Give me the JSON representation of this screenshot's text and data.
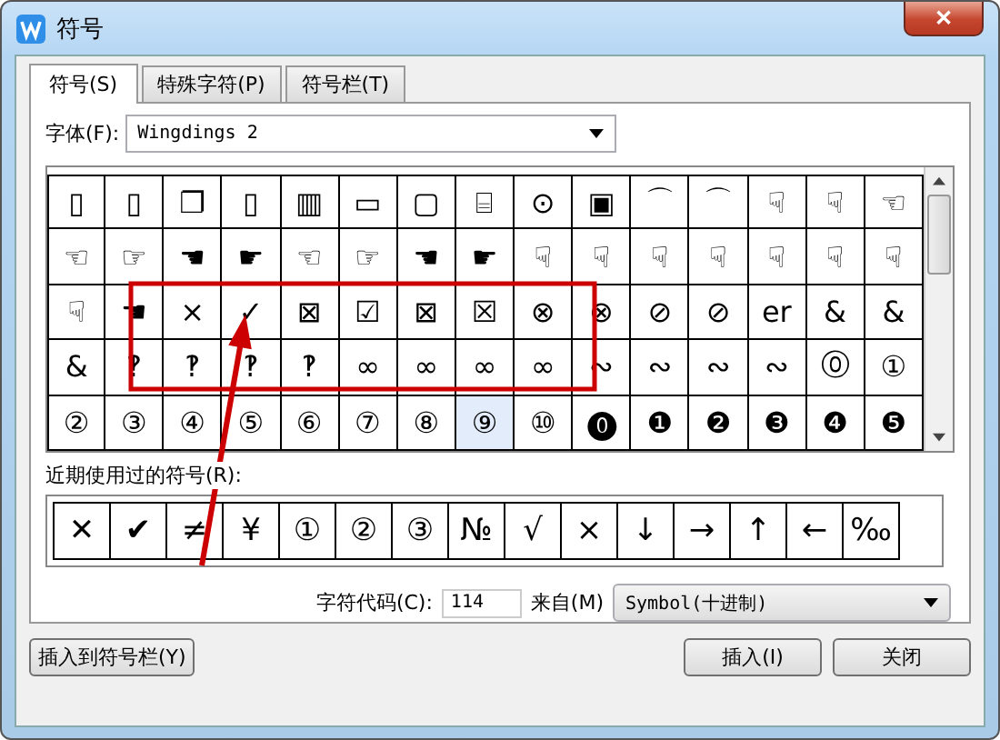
{
  "window": {
    "title": "符号",
    "close": "✕"
  },
  "tabs": [
    {
      "label": "符号(S)",
      "selected": true
    },
    {
      "label": "特殊字符(P)",
      "selected": false
    },
    {
      "label": "符号栏(T)",
      "selected": false
    }
  ],
  "font": {
    "label": "字体(F):",
    "value": "Wingdings 2"
  },
  "symbols": [
    {
      "cells": [
        "▯",
        "▯",
        "❐",
        "▯",
        "▥",
        "▭",
        "▢",
        "⌸",
        "⊙",
        "▣",
        "⌒",
        "⌒",
        "☟",
        "☟",
        "☜"
      ],
      "selected": [
        false,
        false,
        false,
        false,
        false,
        false,
        false,
        false,
        false,
        false,
        false,
        false,
        false,
        false,
        false
      ]
    },
    {
      "cells": [
        "☜",
        "☞",
        "☚",
        "☛",
        "☜",
        "☞",
        "☚",
        "☛",
        "☟",
        "☟",
        "☟",
        "☟",
        "☟",
        "☟",
        "☟"
      ],
      "selected": [
        false,
        false,
        false,
        false,
        false,
        false,
        false,
        false,
        false,
        false,
        false,
        false,
        false,
        false,
        false
      ]
    },
    {
      "cells": [
        "☟",
        "☚",
        "×",
        "✓",
        "⊠",
        "☑",
        "⊠",
        "☒",
        "⊗",
        "⊗",
        "⊘",
        "⊘",
        "er",
        "&",
        "&"
      ],
      "selected": [
        false,
        false,
        false,
        false,
        false,
        false,
        false,
        false,
        false,
        false,
        false,
        false,
        false,
        false,
        false
      ]
    },
    {
      "cells": [
        "&",
        "‽",
        "‽",
        "‽",
        "‽",
        "∞",
        "∞",
        "∞",
        "∞",
        "∾",
        "∾",
        "∾",
        "∾",
        "⓪",
        "①"
      ],
      "selected": [
        false,
        false,
        false,
        false,
        false,
        false,
        false,
        false,
        false,
        false,
        false,
        false,
        false,
        false,
        false
      ]
    },
    {
      "cells": [
        "②",
        "③",
        "④",
        "⑤",
        "⑥",
        "⑦",
        "⑧",
        "⑨",
        "⑩",
        "⓿",
        "❶",
        "❷",
        "❸",
        "❹",
        "❺"
      ],
      "selected": [
        false,
        false,
        false,
        false,
        false,
        false,
        false,
        true,
        false,
        false,
        false,
        false,
        false,
        false,
        false
      ]
    }
  ],
  "recent": {
    "label": "近期使用过的符号(R):",
    "items": [
      "✕",
      "✔",
      "≠",
      "¥",
      "①",
      "②",
      "③",
      "№",
      "√",
      "×",
      "↓",
      "→",
      "↑",
      "←",
      "‰"
    ]
  },
  "char_code": {
    "label": "字符代码(C):",
    "value": "114",
    "from_label": "来自(M)",
    "from_value": "Symbol(十进制)"
  },
  "buttons": [
    {
      "label": "插入到符号栏(Y)",
      "kind": "left"
    },
    {
      "label": "插入(I)",
      "kind": "right"
    },
    {
      "label": "关闭",
      "kind": "right"
    }
  ]
}
